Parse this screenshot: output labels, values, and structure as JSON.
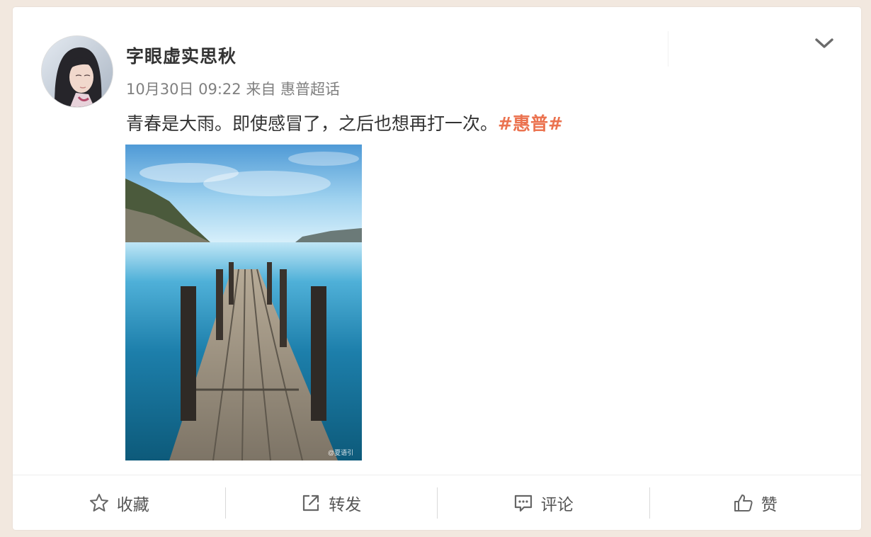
{
  "post": {
    "username": "字眼虚实思秋",
    "time": "10月30日 09:22",
    "via": "来自",
    "source": "惠普超话",
    "text": "青春是大雨。即使感冒了，之后也想再打一次。",
    "topic": "#惠普#",
    "image_watermark": "@夏语引"
  },
  "actions": {
    "favorite": "收藏",
    "repost": "转发",
    "comment": "评论",
    "like": "赞"
  },
  "colors": {
    "page_bg": "#f2e8df",
    "card_bg": "#ffffff",
    "topic": "#eb7350",
    "meta": "#808080"
  },
  "icons": {
    "expand": "chevron-down-icon",
    "favorite": "star-icon",
    "repost": "share-arrow-icon",
    "comment": "comment-bubble-icon",
    "like": "thumbs-up-icon"
  }
}
